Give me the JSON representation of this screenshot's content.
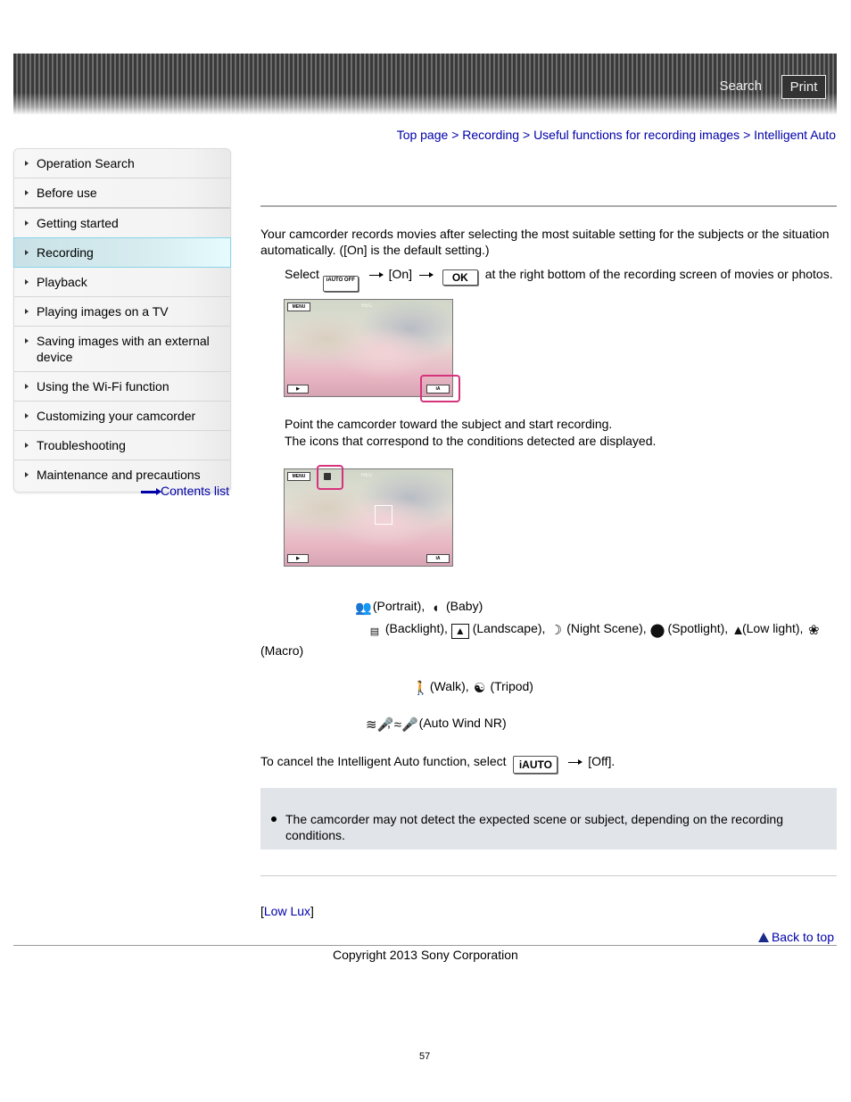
{
  "header": {
    "search_label": "Search",
    "print_label": "Print"
  },
  "breadcrumb": {
    "items": [
      "Top page",
      "Recording",
      "Useful functions for recording images",
      "Intelligent Auto"
    ],
    "separator": ">"
  },
  "sidebar": {
    "items": [
      {
        "label": "Operation Search"
      },
      {
        "label": "Before use"
      },
      {
        "label": "Getting started"
      },
      {
        "label": "Recording",
        "active": true
      },
      {
        "label": "Playback"
      },
      {
        "label": "Playing images on a TV"
      },
      {
        "label": "Saving images with an external device"
      },
      {
        "label": "Using the Wi-Fi function"
      },
      {
        "label": "Customizing your camcorder"
      },
      {
        "label": "Troubleshooting"
      },
      {
        "label": "Maintenance and precautions"
      }
    ],
    "contents_list_label": "Contents list",
    "active_color": "#88d4ea"
  },
  "main": {
    "intro": "Your camcorder records movies after selecting the most suitable setting for the subjects or the situation automatically. ([On] is the default setting.)",
    "step1": {
      "prefix": "Select",
      "iauto_off_icon": "iAUTO OFF",
      "on_label": "[On]",
      "ok_icon": "OK",
      "suffix": "at the right bottom of the recording screen of movies or photos."
    },
    "screen1": {
      "menu_label": "MENU",
      "rec_label": "REC",
      "highlight": "intelligent-auto-button",
      "highlight_color": "#d6337c"
    },
    "step2": {
      "line1": "Point the camcorder toward the subject and start recording.",
      "line2": "The icons that correspond to the conditions detected are displayed."
    },
    "screen2": {
      "menu_label": "MENU",
      "rec_label": "REC",
      "highlight": "scene-icon"
    },
    "detections": {
      "face": [
        {
          "icon": "portrait-icon",
          "label": "(Portrait),"
        },
        {
          "icon": "baby-icon",
          "label": "(Baby)"
        }
      ],
      "scene": [
        {
          "icon": "backlight-icon",
          "label": "(Backlight),"
        },
        {
          "icon": "landscape-icon",
          "label": "(Landscape),"
        },
        {
          "icon": "night-scene-icon",
          "label": "(Night Scene),"
        },
        {
          "icon": "spotlight-icon",
          "label": "(Spotlight),"
        },
        {
          "icon": "low-light-icon",
          "label": "(Low light),"
        },
        {
          "icon": "macro-icon",
          "label": "(Macro)"
        }
      ],
      "camera_shake": [
        {
          "icon": "walk-icon",
          "label": "(Walk),"
        },
        {
          "icon": "tripod-icon",
          "label": "(Tripod)"
        }
      ],
      "sound": {
        "icons": [
          "auto-wind-nr-strong-icon",
          "auto-wind-nr-icon"
        ],
        "separator": ",",
        "label": "(Auto Wind NR)"
      }
    },
    "cancel": {
      "prefix": "To cancel the Intelligent Auto function, select",
      "iauto_icon": "iAUTO",
      "suffix": "[Off]."
    },
    "note": {
      "text": "The camcorder may not detect the expected scene or subject, depending on the recording conditions."
    },
    "related": {
      "open": "[",
      "link": "Low Lux",
      "close": "]"
    },
    "back_to_top": "Back to top"
  },
  "footer": {
    "copyright": "Copyright 2013 Sony Corporation",
    "page_number": "57"
  }
}
